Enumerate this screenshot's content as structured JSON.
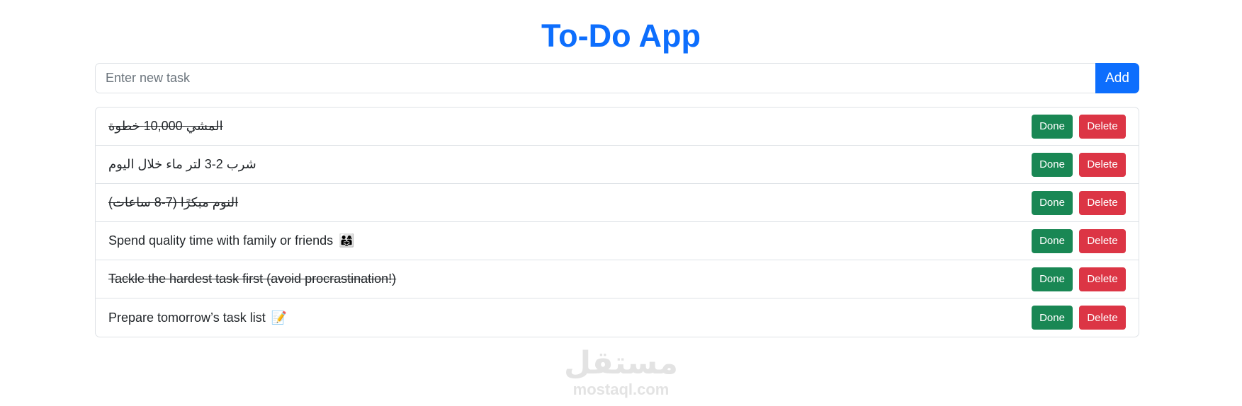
{
  "header": {
    "title": "To-Do App"
  },
  "new_task": {
    "placeholder": "Enter new task",
    "value": "",
    "add_label": "Add"
  },
  "tasks": [
    {
      "text": "المشي 10,000 خطوة",
      "completed": true,
      "emoji": "",
      "done_label": "Done",
      "delete_label": "Delete"
    },
    {
      "text": "شرب 2-3 لتر ماء خلال اليوم",
      "completed": false,
      "emoji": "",
      "done_label": "Done",
      "delete_label": "Delete"
    },
    {
      "text": "النوم مبكرًا (7-8 ساعات)",
      "completed": true,
      "emoji": "",
      "done_label": "Done",
      "delete_label": "Delete"
    },
    {
      "text": "Spend quality time with family or friends",
      "completed": false,
      "emoji": "👨‍👩‍👧",
      "done_label": "Done",
      "delete_label": "Delete"
    },
    {
      "text": "Tackle the hardest task first (avoid procrastination!)",
      "completed": true,
      "emoji": "",
      "done_label": "Done",
      "delete_label": "Delete"
    },
    {
      "text": "Prepare tomorrow’s task list",
      "completed": false,
      "emoji": "📝",
      "done_label": "Done",
      "delete_label": "Delete"
    }
  ],
  "watermark": {
    "logo_text": "مستقل",
    "url_text": "mostaql.com"
  },
  "colors": {
    "primary": "#0d6efd",
    "success": "#198754",
    "danger": "#dc3545",
    "border": "#dee2e6"
  }
}
